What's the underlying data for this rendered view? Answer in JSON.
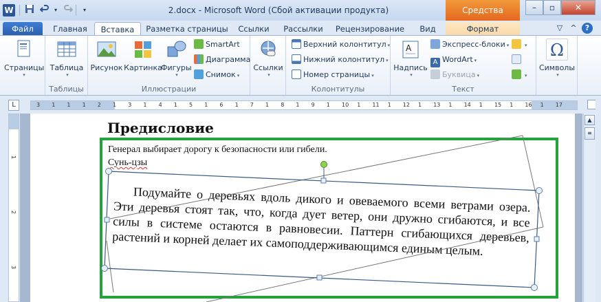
{
  "window": {
    "title": "2.docx  -  Microsoft Word (Сбой активации продукта)",
    "context_header": "Средства рисов..."
  },
  "qat": {
    "app_icon": "W",
    "save_icon": "save-icon",
    "undo_icon": "undo-icon",
    "redo_icon": "redo-icon"
  },
  "tabs": {
    "file": "Файл",
    "home": "Главная",
    "insert": "Вставка",
    "layout": "Разметка страницы",
    "references": "Ссылки",
    "mailings": "Рассылки",
    "review": "Рецензирование",
    "view": "Вид",
    "format": "Формат"
  },
  "ribbon": {
    "pages": {
      "label": "Страницы"
    },
    "tables": {
      "table": "Таблица",
      "group": "Таблицы"
    },
    "illustrations": {
      "picture": "Рисунок",
      "clipart": "Картинка",
      "shapes": "Фигуры",
      "smartart": "SmartArt",
      "chart": "Диаграмма",
      "screenshot": "Снимок",
      "group": "Иллюстрации"
    },
    "links": {
      "label": "Ссылки"
    },
    "header_footer": {
      "header": "Верхний колонтитул",
      "footer": "Нижний колонтитул",
      "page_number": "Номер страницы",
      "group": "Колонтитулы"
    },
    "text": {
      "textbox": "Надпись",
      "quickparts": "Экспресс-блоки",
      "wordart": "WordArt",
      "dropcap": "Буквица",
      "group": "Текст"
    },
    "symbols": {
      "label": "Символы",
      "omega": "Ω"
    }
  },
  "ruler": {
    "corner": "L",
    "numbers": [
      "3",
      "1",
      "1",
      "1",
      "2",
      "1",
      "3",
      "1",
      "4",
      "1",
      "5",
      "1",
      "6",
      "1",
      "7",
      "1",
      "8",
      "1",
      "9",
      "1",
      "10",
      "1",
      "11",
      "1",
      "12",
      "1",
      "13",
      "1",
      "14",
      "1",
      "15",
      "1",
      "16",
      "1",
      "17"
    ]
  },
  "vruler": {
    "numbers": [
      "1",
      "2",
      "3"
    ]
  },
  "document": {
    "heading": "Предисловие",
    "epigraph_line1": "Генерал выбирает дорогу к безопасности или гибели.",
    "epigraph_line2": "Сунь-цзы",
    "paragraph": "Подумайте о деревьях вдоль дикого и овеваемого всеми ветрами озера. Эти деревья стоят так, что, когда дует ветер, они дружно сгибаются, и все силы в системе остаются в равновесии. Паттерн сгибающихся деревьев, растений и корней делает их самоподдерживающимся единым целым."
  },
  "colors": {
    "frame_green": "#22a33c",
    "file_tab": "#2a5ea8",
    "context_tab": "#e4661e"
  }
}
